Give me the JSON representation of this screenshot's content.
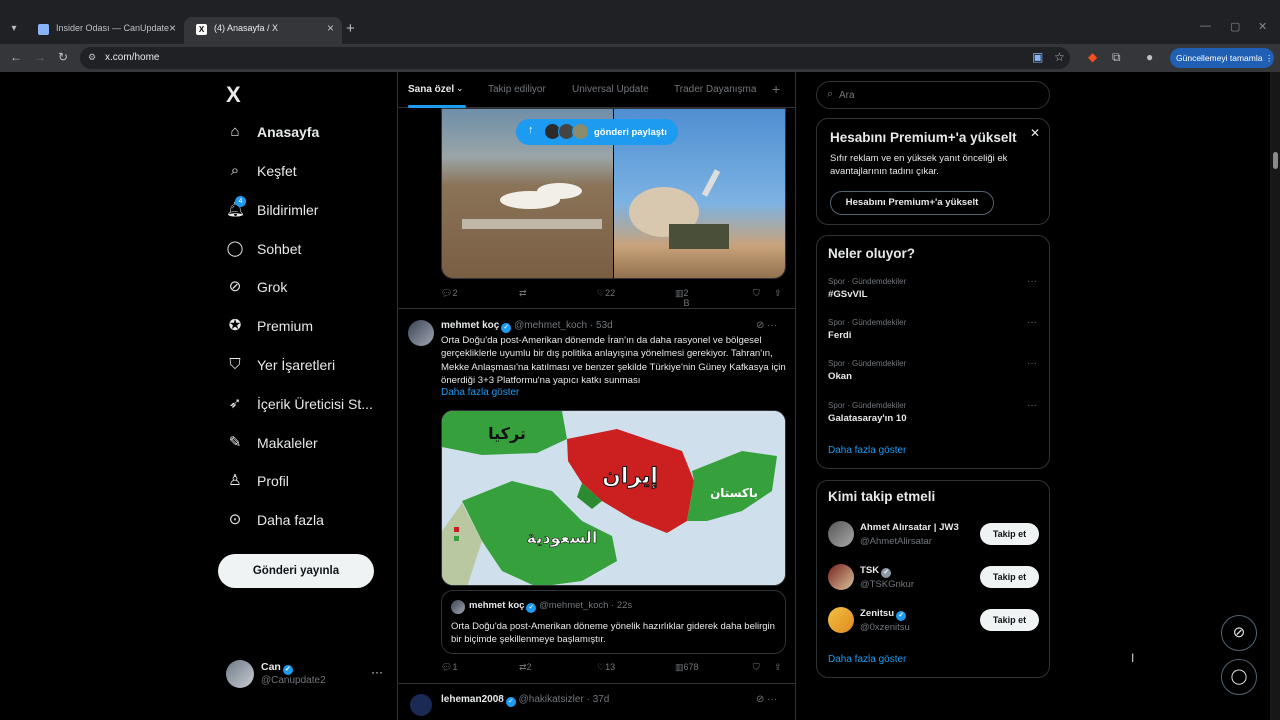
{
  "browser": {
    "tabs": [
      {
        "title": "Insider Odası — CanUpdate"
      },
      {
        "title": "(4) Anasayfa / X"
      }
    ],
    "url": "x.com/home",
    "update_button": "Güncellemeyi tamamla"
  },
  "nav": {
    "logo": "X",
    "items": [
      {
        "label": "Anasayfa",
        "icon": "home-icon"
      },
      {
        "label": "Keşfet",
        "icon": "search-icon"
      },
      {
        "label": "Bildirimler",
        "icon": "bell-icon",
        "badge": "4"
      },
      {
        "label": "Sohbet",
        "icon": "chat-icon"
      },
      {
        "label": "Grok",
        "icon": "grok-icon"
      },
      {
        "label": "Premium",
        "icon": "premium-icon"
      },
      {
        "label": "Yer İşaretleri",
        "icon": "bookmark-icon"
      },
      {
        "label": "İçerik Üreticisi St...",
        "icon": "rocket-icon"
      },
      {
        "label": "Makaleler",
        "icon": "article-icon"
      },
      {
        "label": "Profil",
        "icon": "person-icon"
      },
      {
        "label": "Daha fazla",
        "icon": "more-circle-icon"
      }
    ],
    "post_button": "Gönderi yayınla",
    "account": {
      "name": "Can",
      "handle": "@Canupdate2"
    }
  },
  "feed": {
    "tabs": [
      "Sana özel",
      "Takip ediliyor",
      "Universal Update",
      "Trader Dayanışma"
    ],
    "active_tab": "Sana özel",
    "new_posts_pill": "gönderi paylaştı",
    "tweet1": {
      "replies": "2",
      "reposts": "",
      "likes": "22",
      "views": "2 B"
    },
    "tweet2": {
      "name": "mehmet koç",
      "handle": "@mehmet_koch",
      "time": "53d",
      "text": "Orta Doğu'da post-Amerikan dönemde İran'ın da daha rasyonel ve bölgesel gerçekliklerle uyumlu bir dış politika anlayışına yönelmesi gerekiyor. Tahran'ın, Mekke Anlaşması'na katılması ve benzer şekilde Türkiye'nin Güney Kafkasya için önerdiği 3+3 Platformu'na yapıcı katkı sunması",
      "show_more": "Daha fazla göster",
      "map_labels": {
        "turkey": "تركيا",
        "iran": "إيران",
        "pakistan": "باكستان",
        "saudi": "السعودية"
      },
      "quote": {
        "name": "mehmet koç",
        "handle": "@mehmet_koch",
        "time": "22s",
        "text": "Orta Doğu'da post-Amerikan döneme yönelik hazırlıklar giderek daha belirgin bir biçimde şekillenmeye başlamıştır."
      },
      "replies": "1",
      "reposts": "2",
      "likes": "13",
      "views": "678"
    },
    "tweet3": {
      "name": "leheman2008",
      "handle": "@hakikatsizler",
      "time": "37d"
    }
  },
  "sidebar": {
    "search_placeholder": "Ara",
    "premium": {
      "title": "Hesabını Premium+'a yükselt",
      "desc": "Sıfır reklam ve en yüksek yanıt önceliği ek avantajlarının tadını çıkar.",
      "button": "Hesabını Premium+'a yükselt"
    },
    "trends": {
      "title": "Neler oluyor?",
      "items": [
        {
          "category": "Spor · Gündemdekiler",
          "name": "#GSvVIL"
        },
        {
          "category": "Spor · Gündemdekiler",
          "name": "Ferdi"
        },
        {
          "category": "Spor · Gündemdekiler",
          "name": "Okan"
        },
        {
          "category": "Spor · Gündemdekiler",
          "name": "Galatasaray'ın 10"
        }
      ],
      "more": "Daha fazla göster"
    },
    "who": {
      "title": "Kimi takip etmeli",
      "items": [
        {
          "name": "Ahmet Alırsatar | JW3",
          "handle": "@AhmetAlirsatar",
          "button": "Takip et"
        },
        {
          "name": "TSK",
          "handle": "@TSKGnkur",
          "button": "Takip et"
        },
        {
          "name": "Zenitsu",
          "handle": "@0xzenitsu",
          "button": "Takip et"
        }
      ],
      "more": "Daha fazla göster"
    }
  },
  "colors": {
    "accent": "#1d9bf0",
    "background": "#000000",
    "border": "#2f3336",
    "muted": "#71767b"
  }
}
